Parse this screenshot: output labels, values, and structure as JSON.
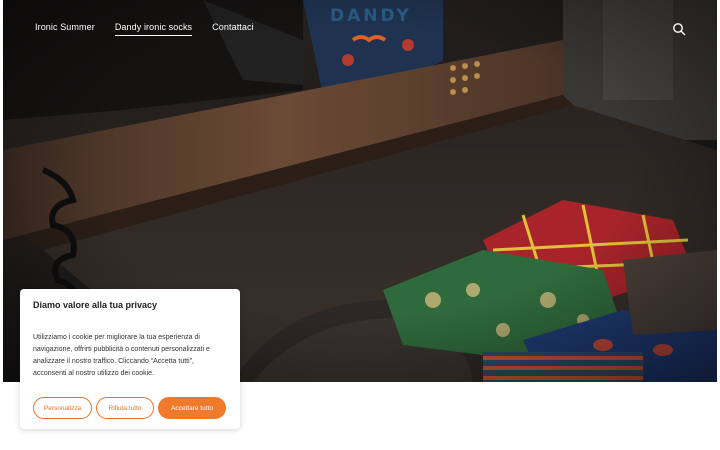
{
  "nav": {
    "items": [
      {
        "label": "Ironic Summer",
        "active": false
      },
      {
        "label": "Dandy ironic socks",
        "active": true
      },
      {
        "label": "Contattaci",
        "active": false
      }
    ]
  },
  "logo": {
    "text": "DANDY"
  },
  "search": {
    "icon": "search-icon"
  },
  "cookie_banner": {
    "title": "Diamo valore alla tua privacy",
    "body": "Utilizziamo i cookie per migliorare la tua esperienza di navigazione, offrirti pubblicità o contenuti personalizzati e analizzare il nostro traffico. Cliccando “Accetta tutti”, acconsenti al nostro utilizzo dei cookie.",
    "buttons": {
      "customize": "Personalizza",
      "reject": "Rifiuta tutto",
      "accept": "Accettare tutto"
    },
    "accent_color": "#f07a2c"
  }
}
